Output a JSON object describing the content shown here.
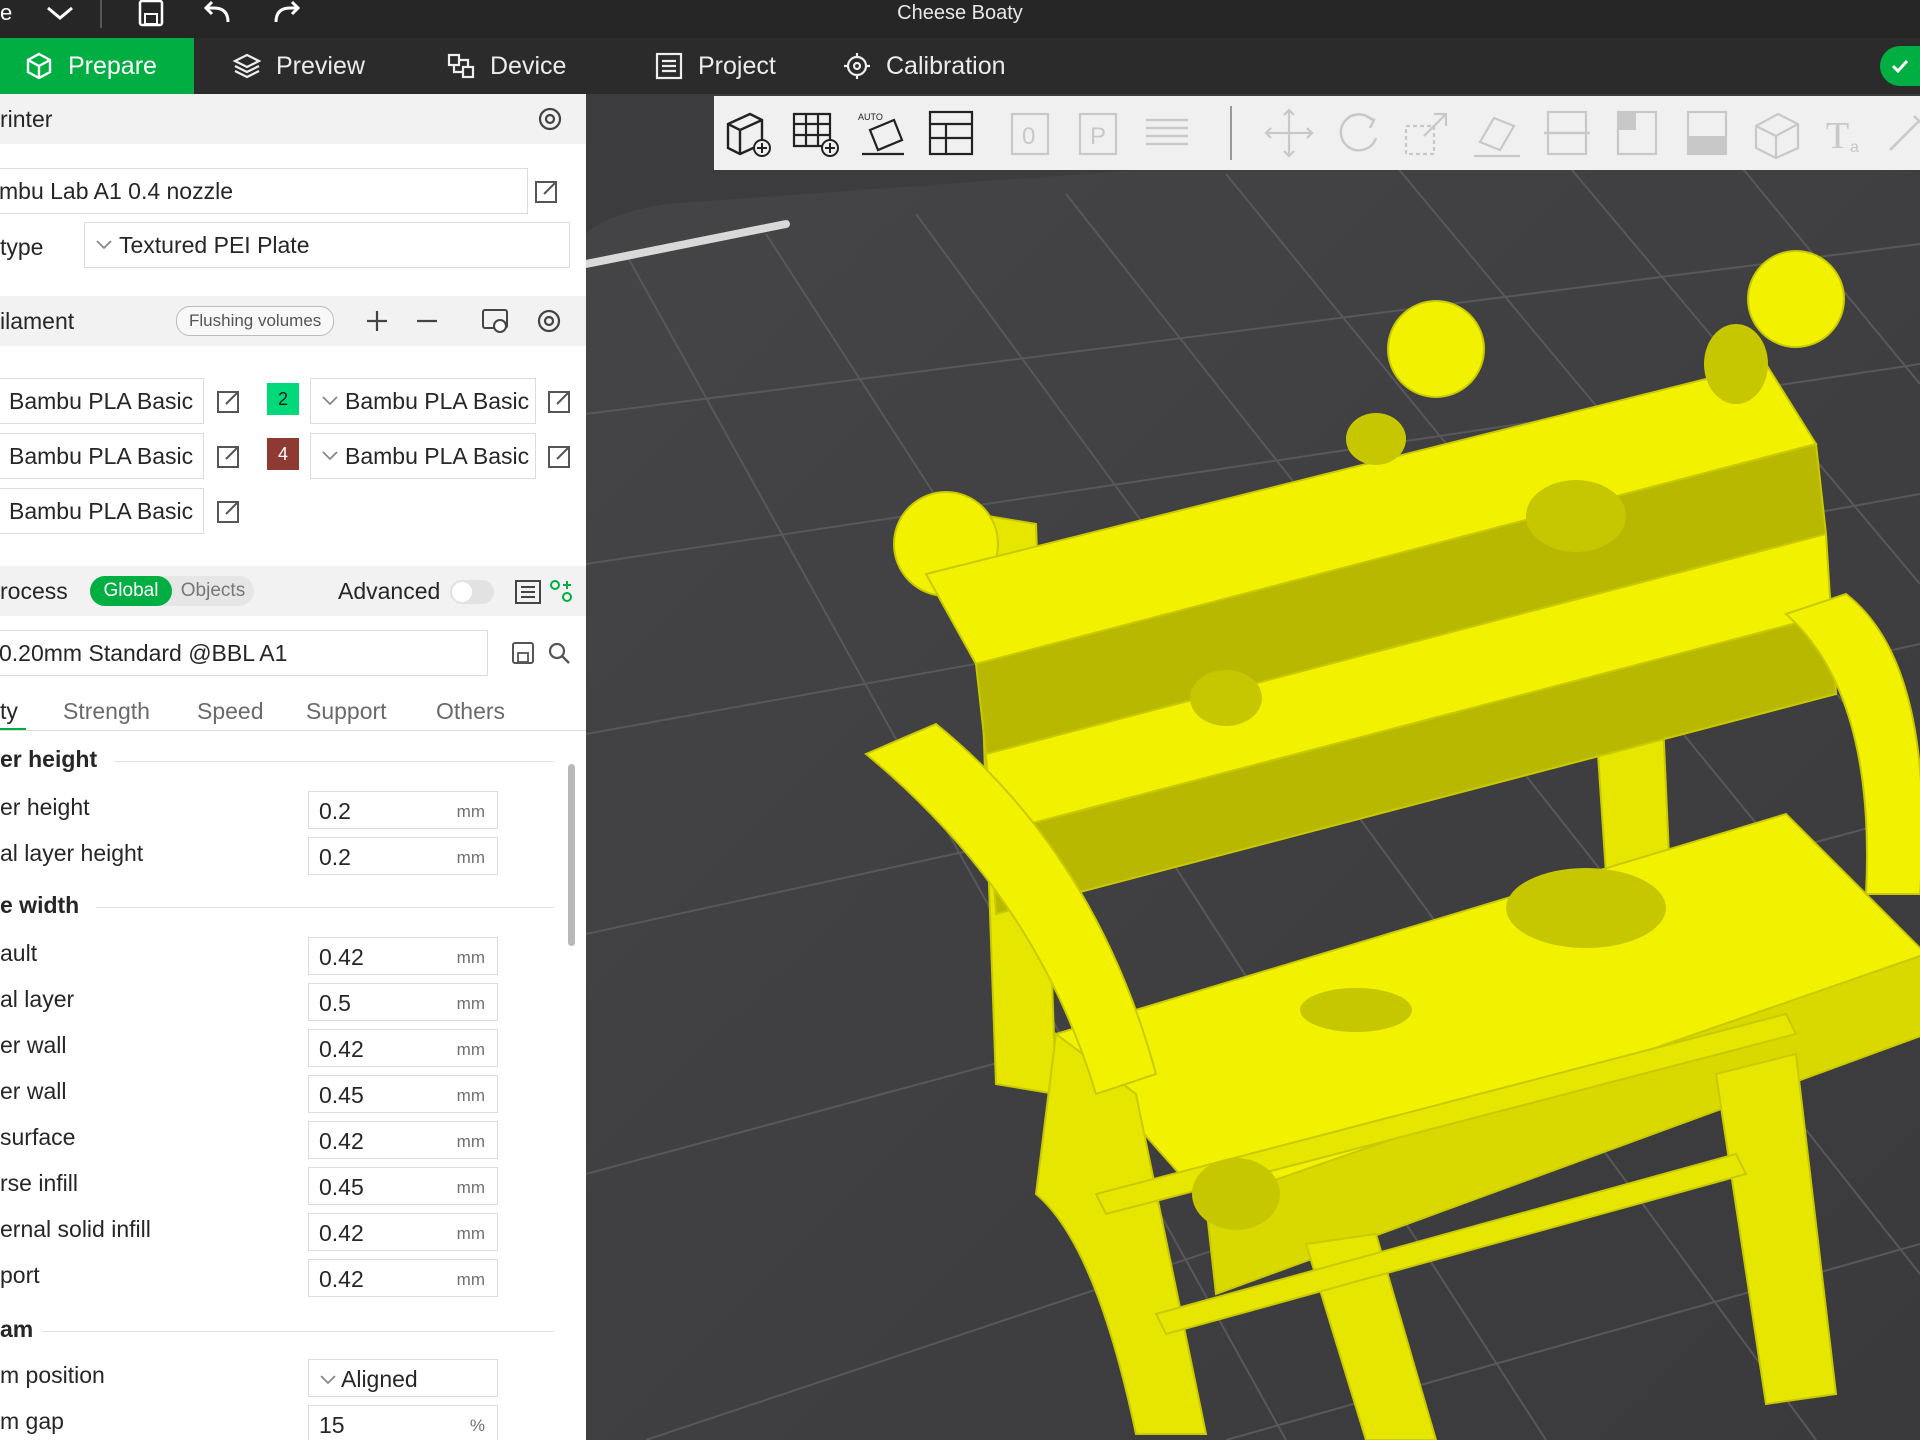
{
  "window": {
    "title": "Cheese Boaty"
  },
  "titlebar": {
    "menu_partial": "e"
  },
  "tabs": [
    {
      "label": "Prepare",
      "icon": "cube-icon"
    },
    {
      "label": "Preview",
      "icon": "layers-icon"
    },
    {
      "label": "Device",
      "icon": "device-icon"
    },
    {
      "label": "Project",
      "icon": "project-icon"
    },
    {
      "label": "Calibration",
      "icon": "calibration-icon"
    }
  ],
  "printer": {
    "header": "rinter",
    "name": "mbu Lab A1 0.4 nozzle",
    "plate_type_label": "type",
    "plate_type": "Textured PEI Plate"
  },
  "filament": {
    "header": "ilament",
    "flushing_button": "Flushing volumes",
    "slots": [
      {
        "name": "Bambu PLA Basic"
      },
      {
        "index": "2",
        "color": "#00d97a",
        "name": "Bambu PLA Basic"
      },
      {
        "name": "Bambu PLA Basic"
      },
      {
        "index": "4",
        "color": "#8e3a33",
        "name": "Bambu PLA Basic"
      },
      {
        "name": "Bambu PLA Basic"
      }
    ]
  },
  "process": {
    "header": "rocess",
    "toggle_global": "Global",
    "toggle_objects": "Objects",
    "advanced_label": "Advanced",
    "advanced_on": false,
    "preset": "0.20mm Standard @BBL A1",
    "subtabs": [
      "ty",
      "Strength",
      "Speed",
      "Support",
      "Others"
    ],
    "groups": {
      "layer_height": "er height",
      "line_width": "e width",
      "seam": "am"
    },
    "fields": {
      "layer_height": {
        "label": "er height",
        "value": "0.2",
        "unit": "mm"
      },
      "initial_layer_height": {
        "label": "al layer height",
        "value": "0.2",
        "unit": "mm"
      },
      "default": {
        "label": "ault",
        "value": "0.42",
        "unit": "mm"
      },
      "initial_layer": {
        "label": "al layer",
        "value": "0.5",
        "unit": "mm"
      },
      "outer_wall": {
        "label": "er wall",
        "value": "0.42",
        "unit": "mm"
      },
      "inner_wall": {
        "label": "er wall",
        "value": "0.45",
        "unit": "mm"
      },
      "top_surface": {
        "label": "surface",
        "value": "0.42",
        "unit": "mm"
      },
      "sparse_infill": {
        "label": "rse infill",
        "value": "0.45",
        "unit": "mm"
      },
      "internal_solid_infill": {
        "label": "ernal solid infill",
        "value": "0.42",
        "unit": "mm"
      },
      "support": {
        "label": "port",
        "value": "0.42",
        "unit": "mm"
      },
      "seam_position": {
        "label": "m position",
        "value": "Aligned"
      },
      "seam_gap": {
        "label": "m gap",
        "value": "15",
        "unit": "%"
      }
    }
  },
  "colors": {
    "accent": "#00ae42",
    "model": "#f2f200",
    "plate": "#3c3c3e"
  }
}
